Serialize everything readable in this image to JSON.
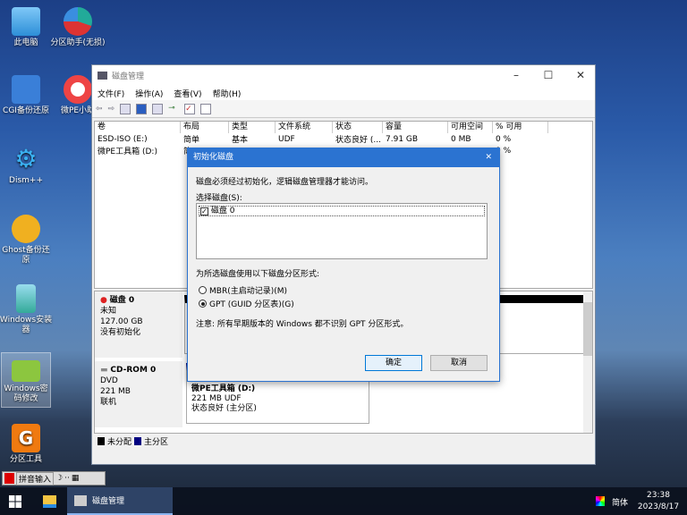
{
  "desktop": {
    "icons": [
      {
        "label": "此电脑",
        "icon": "computer-icon"
      },
      {
        "label": "分区助手(无损)",
        "icon": "partition-assistant-icon"
      },
      {
        "label": "CGI备份还原",
        "icon": "cgi-icon"
      },
      {
        "label": "微PE小助",
        "icon": "lifebuoy-icon"
      },
      {
        "label": "Dism++",
        "icon": "gears-icon"
      },
      {
        "label": "Ghost备份还原",
        "icon": "ghost-icon"
      },
      {
        "label": "Windows安装器",
        "icon": "installer-icon"
      },
      {
        "label": "Windows密码修改",
        "icon": "unlock-icon"
      },
      {
        "label": "分区工具",
        "icon": "diskgenius-icon"
      }
    ]
  },
  "window": {
    "title": "磁盘管理",
    "menu": [
      "文件(F)",
      "操作(A)",
      "查看(V)",
      "帮助(H)"
    ],
    "columns": [
      "卷",
      "布局",
      "类型",
      "文件系统",
      "状态",
      "容量",
      "可用空间",
      "% 可用"
    ],
    "rows": [
      [
        "ESD-ISO (E:)",
        "简单",
        "基本",
        "UDF",
        "状态良好 (...",
        "7.91 GB",
        "0 MB",
        "0 %"
      ],
      [
        "微PE工具箱 (D:)",
        "简",
        "",
        "",
        "",
        "",
        "",
        "0 %"
      ]
    ],
    "disks": [
      {
        "name": "磁盘 0",
        "type": "未知",
        "size": "127.00 GB",
        "status": "没有初始化"
      },
      {
        "name": "CD-ROM 0",
        "type": "DVD",
        "size": "221 MB",
        "status": "联机",
        "partition": {
          "name": "微PE工具箱 (D:)",
          "size": "221 MB UDF",
          "status": "状态良好 (主分区)"
        }
      }
    ],
    "legend": [
      {
        "label": "未分配",
        "color": "#000000"
      },
      {
        "label": "主分区",
        "color": "#000080"
      }
    ]
  },
  "dialog": {
    "title": "初始化磁盘",
    "message": "磁盘必须经过初始化，逻辑磁盘管理器才能访问。",
    "select_label": "选择磁盘(S):",
    "disks": [
      {
        "label": "磁盘 0",
        "checked": true
      }
    ],
    "style_label": "为所选磁盘使用以下磁盘分区形式:",
    "options": [
      {
        "label": "MBR(主启动记录)(M)",
        "selected": false
      },
      {
        "label": "GPT (GUID 分区表)(G)",
        "selected": true
      }
    ],
    "note": "注意: 所有早期版本的 Windows 都不识别 GPT 分区形式。",
    "ok": "确定",
    "cancel": "取消"
  },
  "ime": {
    "label": "拼音输入"
  },
  "taskbar": {
    "task": "磁盘管理",
    "lang": "简体",
    "time": "23:38",
    "date": "2023/8/17"
  }
}
